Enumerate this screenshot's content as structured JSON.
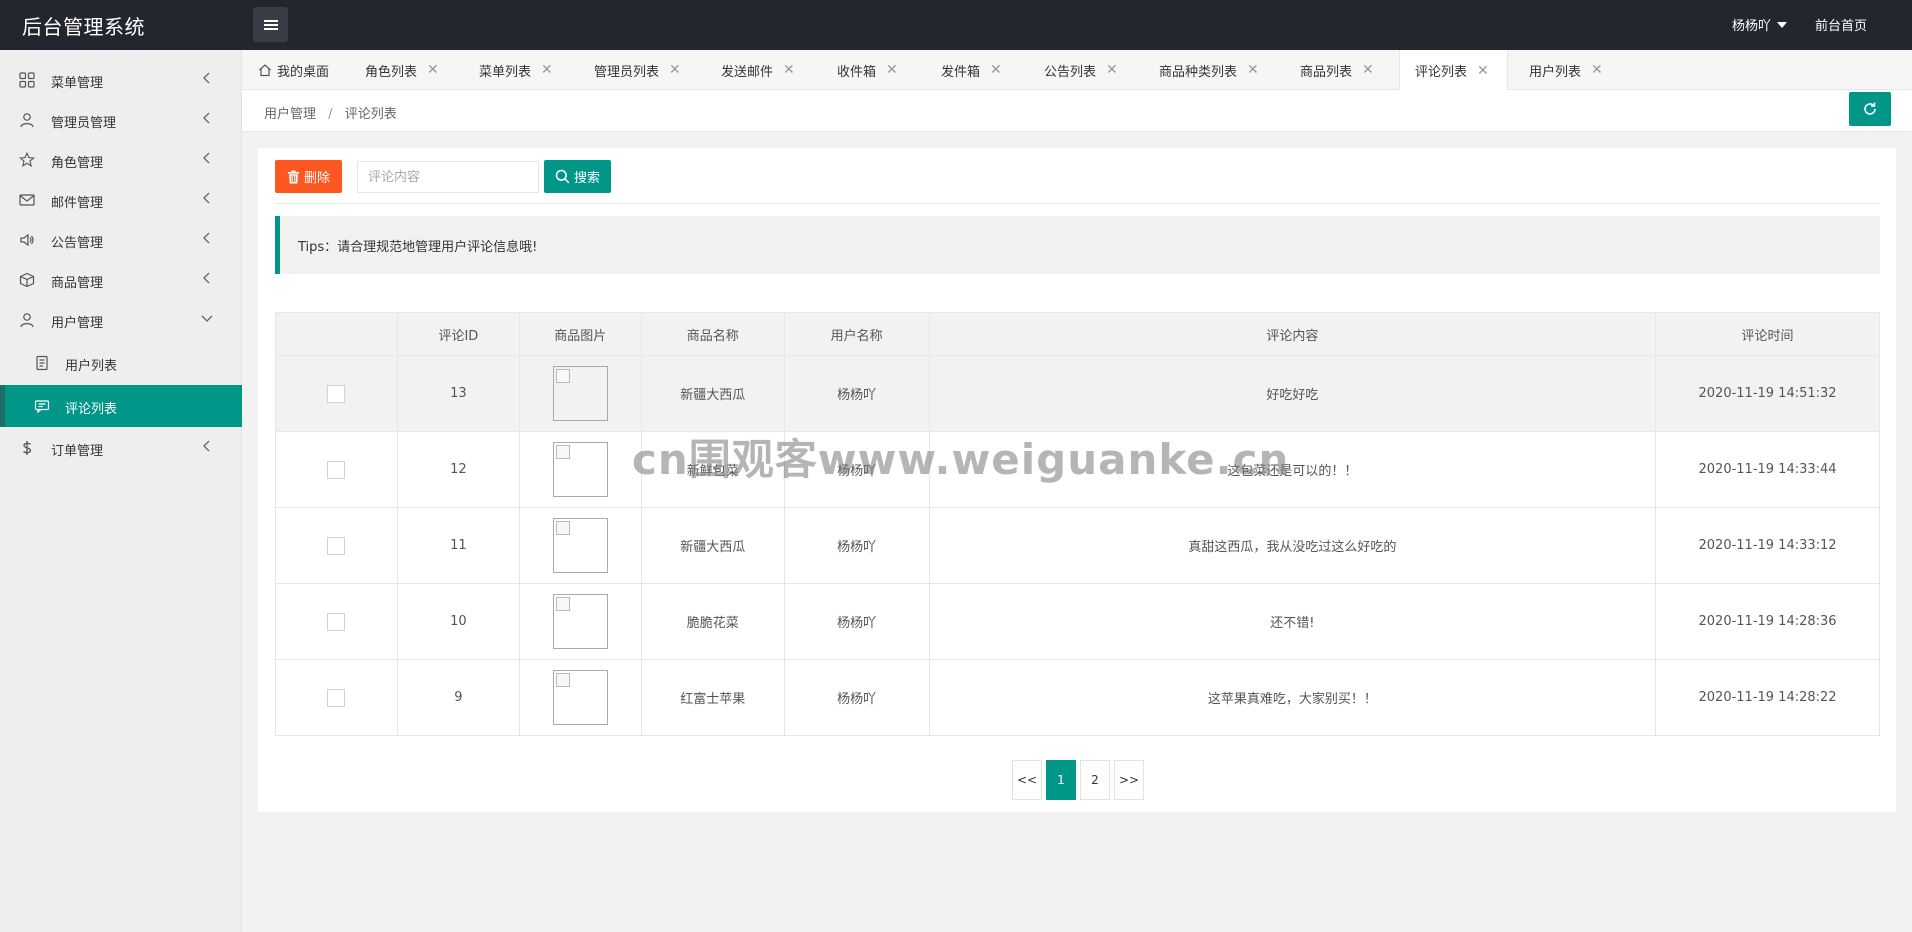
{
  "header": {
    "brand": "后台管理系统",
    "user": "杨杨吖",
    "home_link": "前台首页"
  },
  "sidebar": {
    "items": [
      {
        "label": "菜单管理",
        "icon": "grid-icon"
      },
      {
        "label": "管理员管理",
        "icon": "user-icon"
      },
      {
        "label": "角色管理",
        "icon": "star-icon"
      },
      {
        "label": "邮件管理",
        "icon": "mail-icon"
      },
      {
        "label": "公告管理",
        "icon": "speaker-icon"
      },
      {
        "label": "商品管理",
        "icon": "box-icon"
      },
      {
        "label": "用户管理",
        "icon": "user-icon",
        "expanded": true
      },
      {
        "label": "订单管理",
        "icon": "dollar-icon"
      }
    ],
    "subitems": [
      {
        "label": "用户列表",
        "icon": "document-icon"
      },
      {
        "label": "评论列表",
        "icon": "comment-icon",
        "active": true
      }
    ]
  },
  "tabs": [
    {
      "label": "我的桌面",
      "closable": false
    },
    {
      "label": "角色列表",
      "closable": true
    },
    {
      "label": "菜单列表",
      "closable": true
    },
    {
      "label": "管理员列表",
      "closable": true
    },
    {
      "label": "发送邮件",
      "closable": true
    },
    {
      "label": "收件箱",
      "closable": true
    },
    {
      "label": "发件箱",
      "closable": true
    },
    {
      "label": "公告列表",
      "closable": true
    },
    {
      "label": "商品种类列表",
      "closable": true
    },
    {
      "label": "商品列表",
      "closable": true
    },
    {
      "label": "评论列表",
      "closable": true,
      "active": true
    },
    {
      "label": "用户列表",
      "closable": true
    }
  ],
  "breadcrumb": {
    "parent": "用户管理",
    "separator": "/",
    "current": "评论列表"
  },
  "toolbar": {
    "delete_label": "删除",
    "search_placeholder": "评论内容",
    "search_value": "",
    "search_label": "搜索"
  },
  "tips": "Tips：请合理规范地管理用户评论信息哦!",
  "table": {
    "columns": [
      "",
      "评论ID",
      "商品图片",
      "商品名称",
      "用户名称",
      "评论内容",
      "评论时间"
    ],
    "rows": [
      {
        "id": "13",
        "product": "新疆大西瓜",
        "user": "杨杨吖",
        "content": "好吃好吃",
        "time": "2020-11-19 14:51:32"
      },
      {
        "id": "12",
        "product": "新鲜包菜",
        "user": "杨杨吖",
        "content": "这包菜还是可以的！！",
        "time": "2020-11-19 14:33:44"
      },
      {
        "id": "11",
        "product": "新疆大西瓜",
        "user": "杨杨吖",
        "content": "真甜这西瓜，我从没吃过这么好吃的",
        "time": "2020-11-19 14:33:12"
      },
      {
        "id": "10",
        "product": "脆脆花菜",
        "user": "杨杨吖",
        "content": "还不错!",
        "time": "2020-11-19 14:28:36"
      },
      {
        "id": "9",
        "product": "红富士苹果",
        "user": "杨杨吖",
        "content": "这苹果真难吃，大家别买！！",
        "time": "2020-11-19 14:28:22"
      }
    ]
  },
  "pagination": {
    "prev": "<<",
    "pages": [
      "1",
      "2"
    ],
    "current": "1",
    "next": ">>"
  },
  "watermark": "cn围观客www.weiguanke.cn",
  "colors": {
    "accent": "#009688",
    "danger": "#ff5722",
    "header_bg": "#23262e"
  }
}
